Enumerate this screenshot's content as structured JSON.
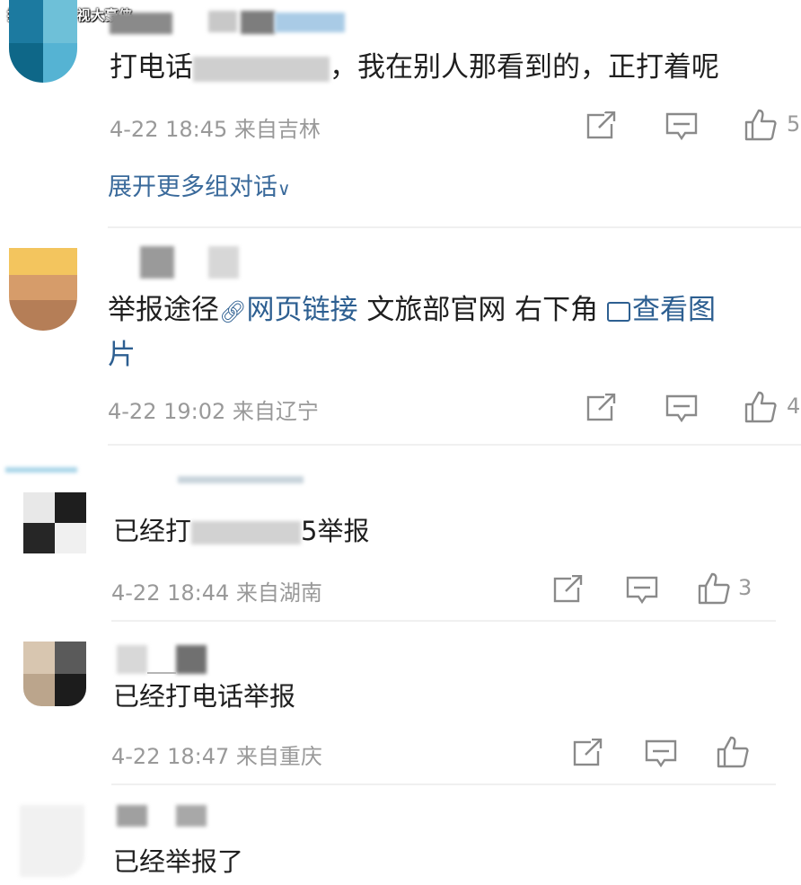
{
  "watermark": "搜狐号@影视大豪侠",
  "comments": [
    {
      "text_prefix": "打电话",
      "text_suffix": "，我在别人那看到的，正打着呢",
      "meta": "4-22 18:45  来自吉林",
      "likes": "5",
      "expand": "展开更多组对话"
    },
    {
      "seg1": "举报途径",
      "link1": "网页链接",
      "seg2": " 文旅部官网 右下角 ",
      "link2": "查看图",
      "line2": "片",
      "meta": "4-22 19:02  来自辽宁",
      "likes": "4"
    },
    {
      "text_prefix": "已经打",
      "text_suffix": "5举报",
      "meta": "4-22 18:44  来自湖南",
      "likes": "3"
    },
    {
      "text": "已经打电话举报",
      "meta": "4-22 18:47  来自重庆"
    },
    {
      "text": "已经举报了"
    }
  ],
  "colors": {
    "link": "#2d5f91",
    "meta": "#999999",
    "icon": "#8a8a8a"
  },
  "icons": [
    "share-icon",
    "comment-icon",
    "like-icon",
    "link-icon",
    "image-icon",
    "chevron-down-icon"
  ]
}
